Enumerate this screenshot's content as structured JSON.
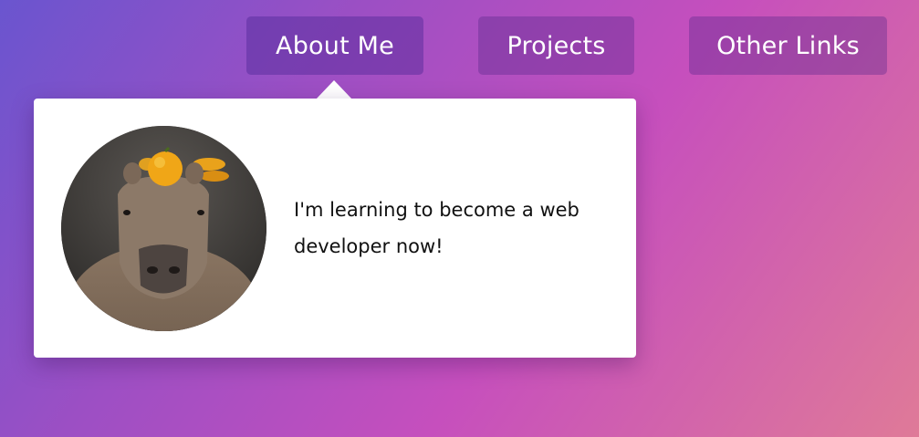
{
  "nav": {
    "items": [
      {
        "label": "About Me"
      },
      {
        "label": "Projects"
      },
      {
        "label": "Other Links"
      }
    ]
  },
  "about_card": {
    "text": "I'm learning to become a web developer now!",
    "image_icon": "capybara-photo"
  },
  "colors": {
    "gradient_start": "#6a55cf",
    "gradient_mid": "#c64fbd",
    "gradient_end": "#df7a98",
    "card_background": "#ffffff"
  }
}
